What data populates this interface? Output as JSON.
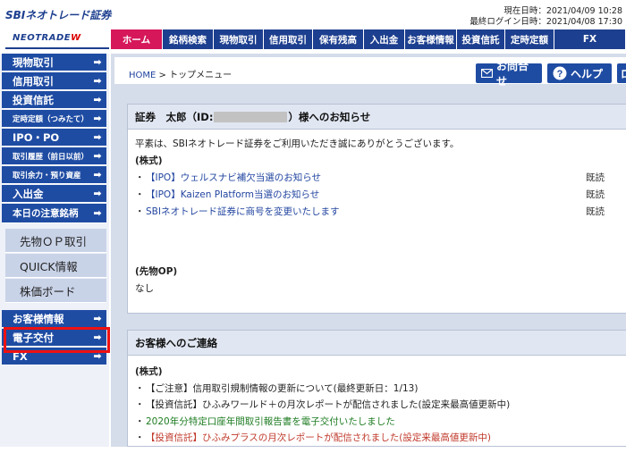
{
  "header": {
    "logo_top": "SBIネオトレード証券",
    "logo_bottom_text": "NEOTRADE",
    "logo_bottom_mark": "W",
    "current_datetime": "現在日時：2021/04/09 10:28",
    "last_login": "最終ログイン日時：2021/04/08 17:30"
  },
  "global_nav": [
    {
      "label": "ホーム"
    },
    {
      "label": "銘柄検索"
    },
    {
      "label": "現物取引"
    },
    {
      "label": "信用取引"
    },
    {
      "label": "保有残高"
    },
    {
      "label": "入出金"
    },
    {
      "label": "お客様情報"
    },
    {
      "label": "投資信託"
    },
    {
      "label": "定時定額"
    },
    {
      "label": "FX"
    }
  ],
  "sidebar": {
    "items": [
      {
        "label": "現物取引"
      },
      {
        "label": "信用取引"
      },
      {
        "label": "投資信託"
      },
      {
        "label": "定時定額（つみたて）"
      },
      {
        "label": "IPO・PO"
      },
      {
        "label": "取引履歴（前日以前）"
      },
      {
        "label": "取引余力・預り資産"
      },
      {
        "label": "入出金"
      },
      {
        "label": "本日の注意銘柄"
      }
    ],
    "sub_items": [
      {
        "label": "先物ＯＰ取引"
      },
      {
        "label": "QUICK情報"
      },
      {
        "label": "株価ボード"
      }
    ],
    "lower_items": [
      {
        "label": "お客様情報"
      },
      {
        "label": "電子交付"
      },
      {
        "label": "FX"
      }
    ],
    "arrow_icon": "arrow-right-icon"
  },
  "topbar": {
    "breadcrumb_home": "HOME",
    "breadcrumb_sep": " > ",
    "breadcrumb_current": "トップメニュー",
    "contact_label": "お問合せ",
    "help_label": "ヘルプ",
    "logout_label": "ロ"
  },
  "notice_panel": {
    "title_prefix": "証券　太郎（ID:",
    "title_suffix": "）様へのお知らせ",
    "greeting": "平素は、SBIネオトレード証券をご利用いただき誠にありがとうございます。",
    "section_stock": "(株式)",
    "news": [
      {
        "title": "【IPO】ウェルスナビ補欠当選のお知らせ",
        "status": "既読"
      },
      {
        "title": "【IPO】Kaizen Platform当選のお知らせ",
        "status": "既読"
      },
      {
        "title": "SBIネオトレード証券に商号を変更いたします",
        "status": "既読"
      }
    ],
    "section_futures": "(先物OP)",
    "futures_text": "なし"
  },
  "contact_panel": {
    "title": "お客様へのご連絡",
    "section_stock": "(株式)",
    "items": [
      {
        "text": "【ご注意】信用取引規制情報の更新について(最終更新日：1/13)",
        "color": "#222222"
      },
      {
        "text": "【投資信託】ひふみワールド＋の月次レポートが配信されました(設定来最高値更新中)",
        "color": "#222222"
      },
      {
        "text": "2020年分特定口座年間取引報告書を電子交付いたしました",
        "color": "#1e7c22"
      },
      {
        "text": "【投資信託】ひふみプラスの月次レポートが配信されました(設定来最高値更新中)",
        "color": "#c0392b"
      }
    ]
  },
  "colors": {
    "nav_home": "#d6175a",
    "nav_blue": "#1d3f8f",
    "sidebar_blue": "#1f4ca3",
    "highlight": "#ee1111"
  }
}
